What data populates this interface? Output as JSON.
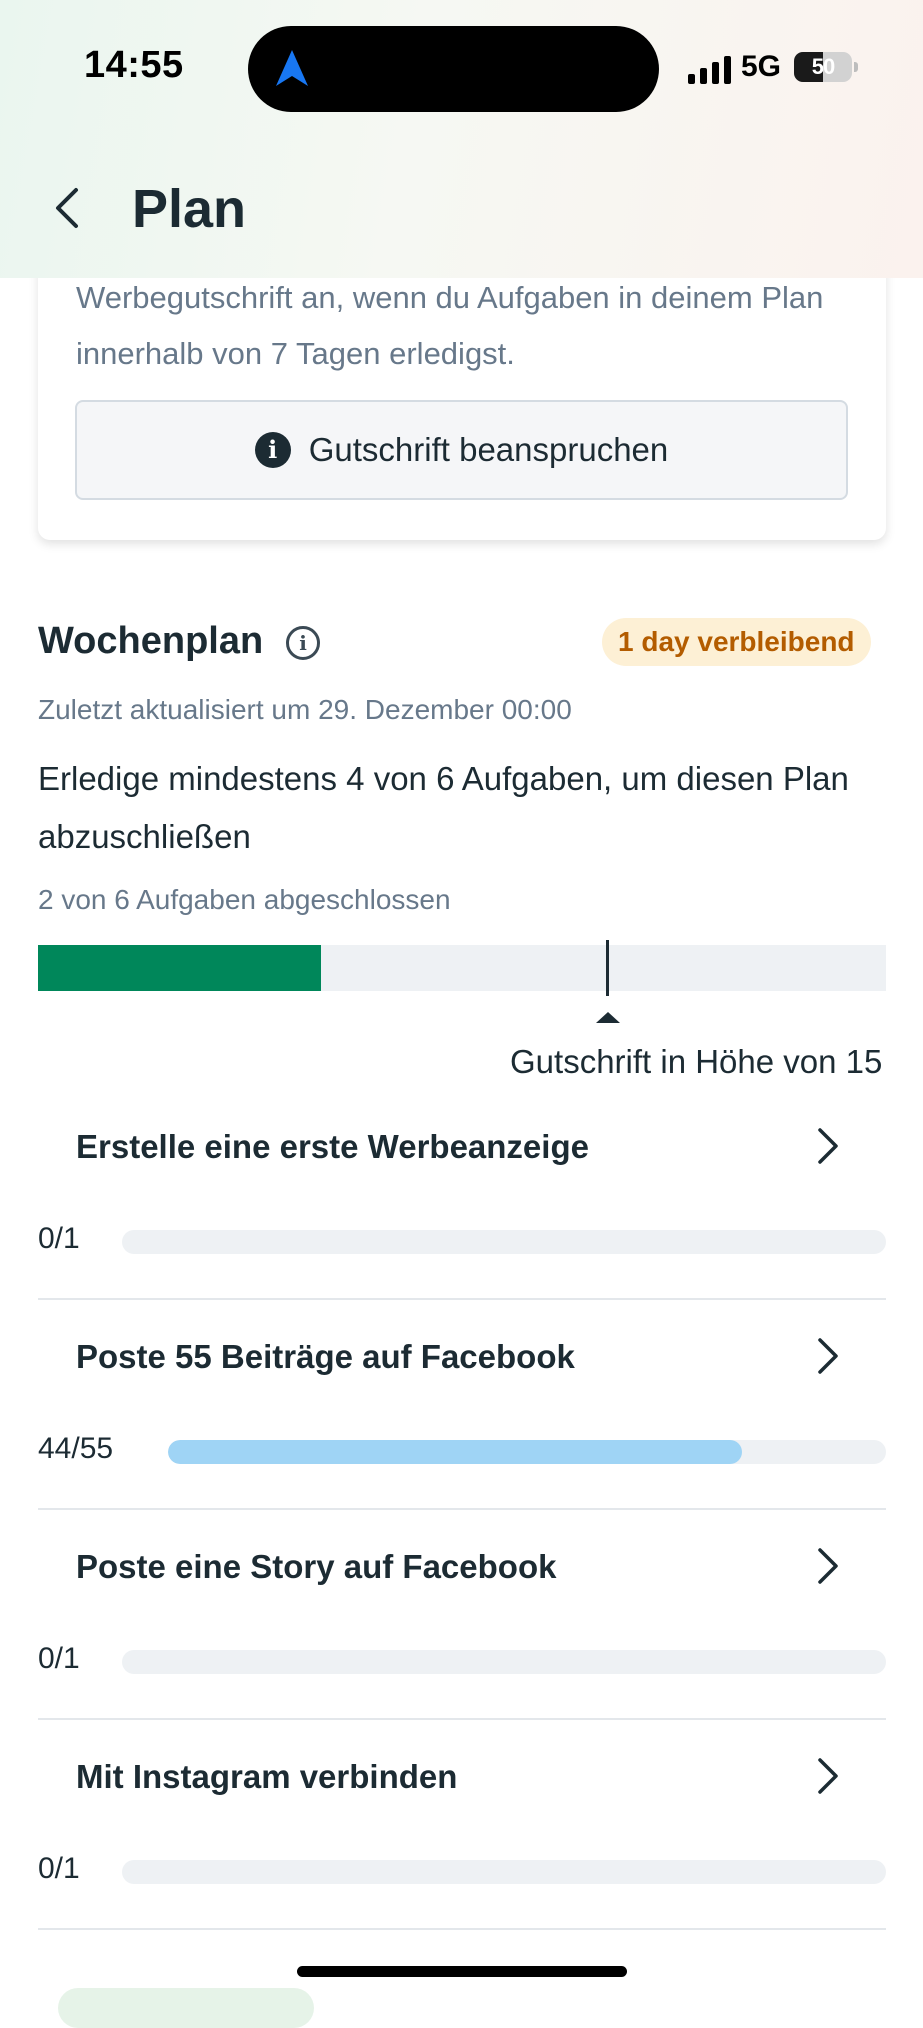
{
  "status_bar": {
    "time": "14:55",
    "network": "5G",
    "battery": "50",
    "battery_level": 0.5
  },
  "header": {
    "title": "Plan"
  },
  "credit_card": {
    "text": "Werbegutschrift an, wenn du Aufgaben in deinem Plan innerhalb von 7 Tagen erledigst.",
    "claim_button": "Gutschrift beanspruchen"
  },
  "weekly_plan": {
    "title": "Wochenplan",
    "days_badge": "1 day verbleibend",
    "updated": "Zuletzt aktualisiert um 29. Dezember 00:00",
    "instruction": "Erledige mindestens 4 von 6 Aufgaben, um diesen Plan abzuschließen",
    "progress_text": "2 von 6 Aufgaben abgeschlossen",
    "completed": 2,
    "total": 6,
    "required": 4,
    "threshold_label": "Gutschrift in Höhe von 15"
  },
  "tasks": [
    {
      "title": "Erstelle eine erste Werbeanzeige",
      "count": "0/1",
      "progress": 0
    },
    {
      "title": "Poste 55 Beiträge auf Facebook",
      "count": "44/55",
      "progress": 0.8
    },
    {
      "title": "Poste eine Story auf Facebook",
      "count": "0/1",
      "progress": 0
    },
    {
      "title": "Mit Instagram verbinden",
      "count": "0/1",
      "progress": 0
    }
  ],
  "colors": {
    "primary_text": "#1c2b33",
    "secondary_text": "#67788a",
    "success_green": "#00875a",
    "task_progress_blue": "#9fd4f5",
    "badge_bg": "#fdf0d5",
    "badge_text": "#b35c00",
    "location_arrow": "#1877f2"
  }
}
